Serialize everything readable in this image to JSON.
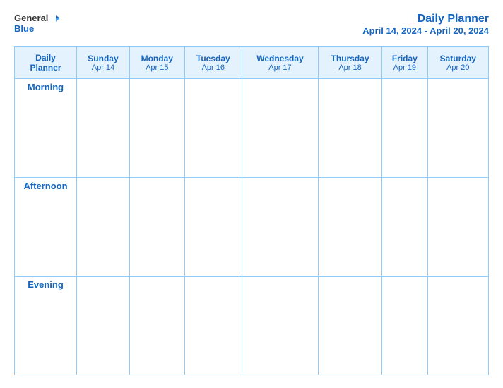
{
  "logo": {
    "general": "General",
    "blue": "Blue"
  },
  "title": {
    "main": "Daily Planner",
    "date_range": "April 14, 2024 - April 20, 2024"
  },
  "table": {
    "header_label": "Daily\nPlanner",
    "days": [
      {
        "name": "Sunday",
        "date": "Apr 14"
      },
      {
        "name": "Monday",
        "date": "Apr 15"
      },
      {
        "name": "Tuesday",
        "date": "Apr 16"
      },
      {
        "name": "Wednesday",
        "date": "Apr 17"
      },
      {
        "name": "Thursday",
        "date": "Apr 18"
      },
      {
        "name": "Friday",
        "date": "Apr 19"
      },
      {
        "name": "Saturday",
        "date": "Apr 20"
      }
    ],
    "rows": [
      {
        "label": "Morning"
      },
      {
        "label": "Afternoon"
      },
      {
        "label": "Evening"
      }
    ]
  }
}
